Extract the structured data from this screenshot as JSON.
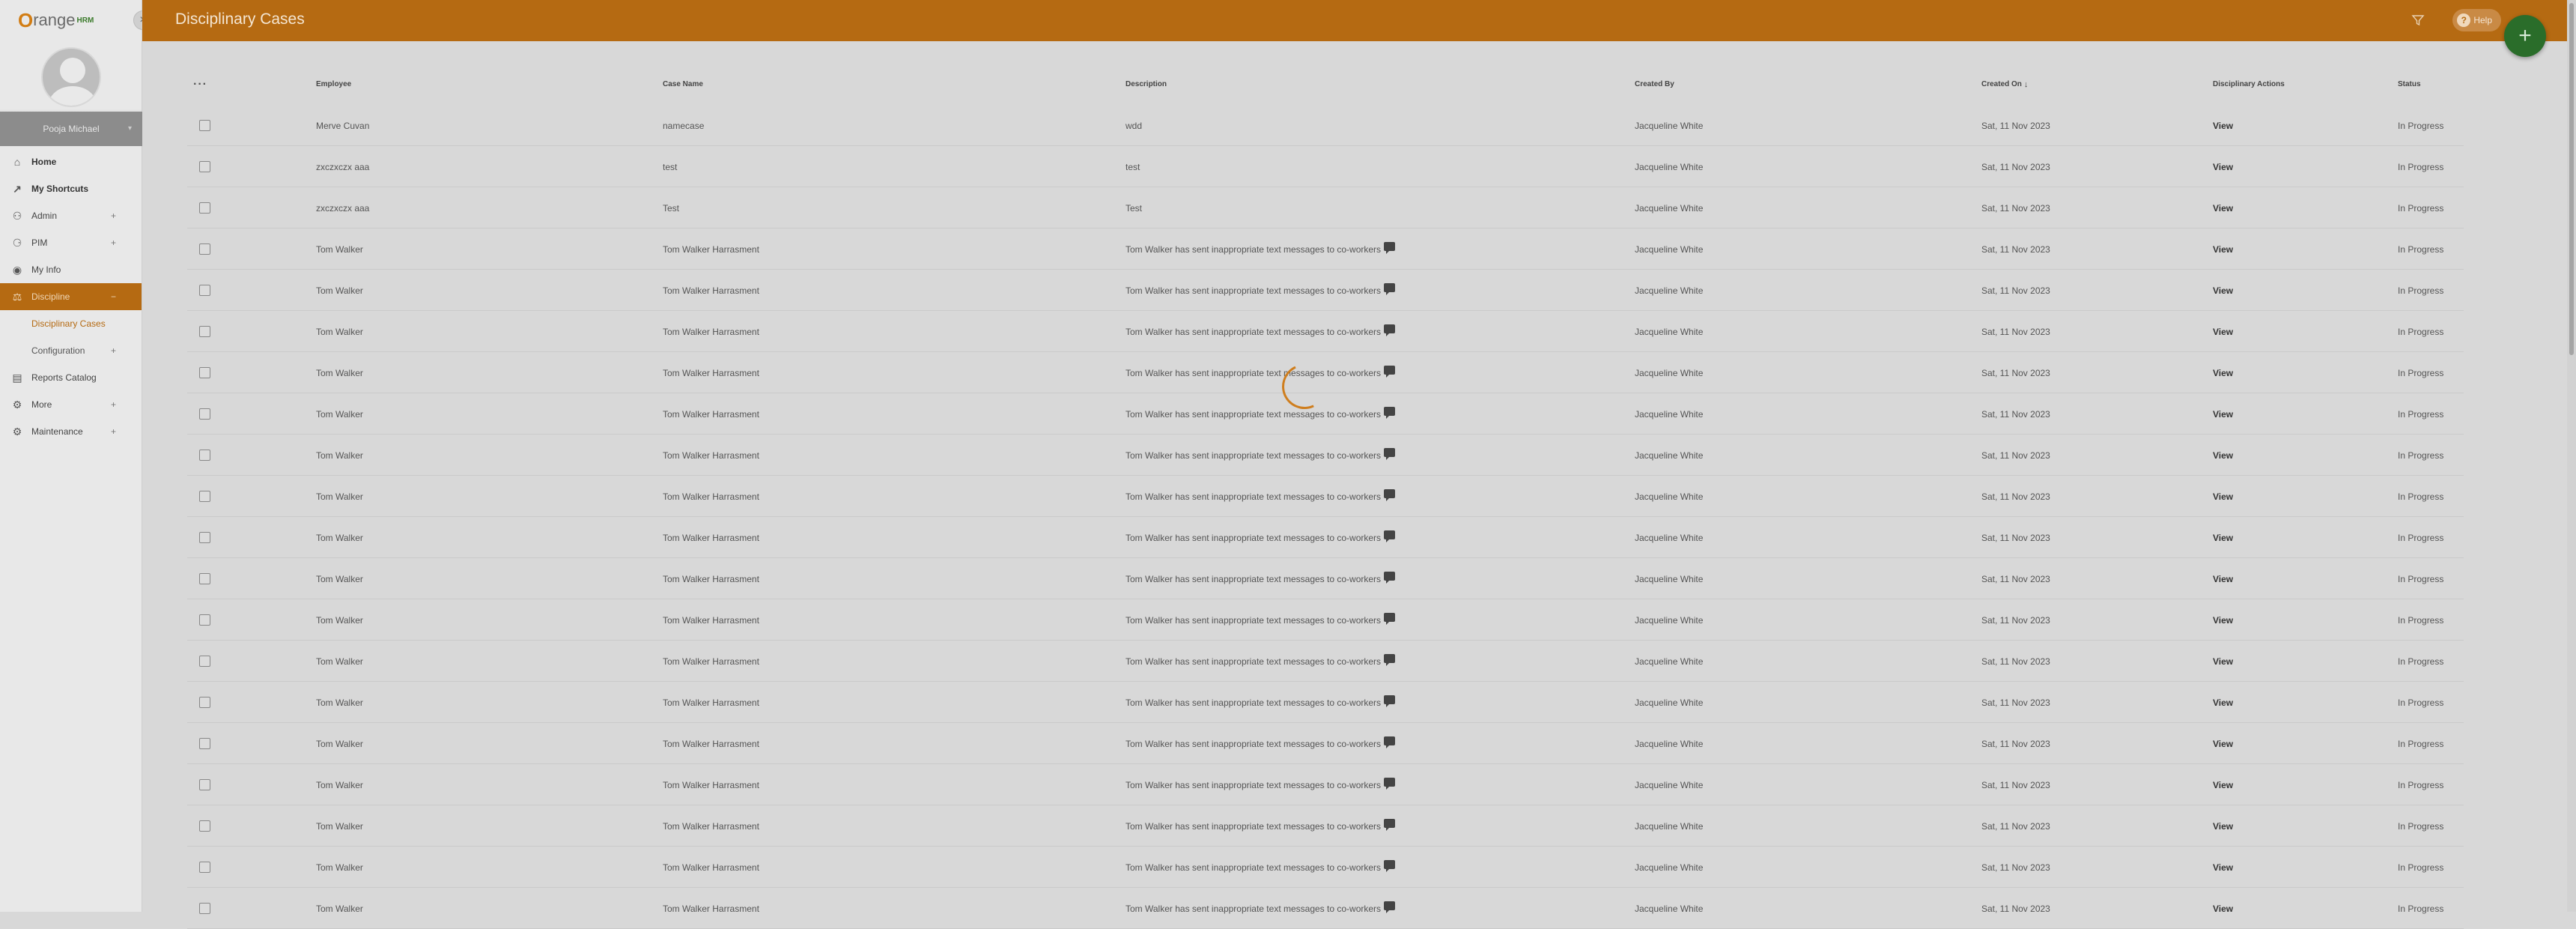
{
  "app": {
    "logo_text": "range",
    "logo_sub": "HRM"
  },
  "sidebar": {
    "user_name": "Pooja Michael",
    "items": [
      {
        "label": "Home",
        "icon": "home-icon",
        "bold": true
      },
      {
        "label": "My Shortcuts",
        "icon": "shortcut-icon",
        "bold": true
      },
      {
        "label": "Admin",
        "icon": "admin-icon",
        "expandable": true
      },
      {
        "label": "PIM",
        "icon": "pim-icon",
        "expandable": true
      },
      {
        "label": "My Info",
        "icon": "user-circle-icon"
      },
      {
        "label": "Discipline",
        "icon": "discipline-icon",
        "active": true
      }
    ],
    "subitems": [
      {
        "label": "Disciplinary Cases",
        "selected": true
      },
      {
        "label": "Configuration",
        "expandable": true
      }
    ],
    "items_after": [
      {
        "label": "Reports Catalog",
        "icon": "reports-icon"
      },
      {
        "label": "More",
        "icon": "more-icon",
        "expandable": true
      },
      {
        "label": "Maintenance",
        "icon": "maintenance-icon",
        "expandable": true
      }
    ]
  },
  "header": {
    "title": "Disciplinary Cases",
    "help_label": "Help"
  },
  "table": {
    "columns": [
      "Employee",
      "Case Name",
      "Description",
      "Created By",
      "Created On",
      "Disciplinary Actions",
      "Status"
    ],
    "rows": [
      {
        "employee": "Merve Cuvan",
        "case": "namecase",
        "desc": "wdd",
        "comment": false,
        "by": "Jacqueline White",
        "on": "Sat, 11 Nov 2023",
        "action": "View",
        "status": "In Progress"
      },
      {
        "employee": "zxczxczx aaa",
        "case": "test",
        "desc": "test",
        "comment": false,
        "by": "Jacqueline White",
        "on": "Sat, 11 Nov 2023",
        "action": "View",
        "status": "In Progress"
      },
      {
        "employee": "zxczxczx aaa",
        "case": "Test",
        "desc": "Test",
        "comment": false,
        "by": "Jacqueline White",
        "on": "Sat, 11 Nov 2023",
        "action": "View",
        "status": "In Progress"
      },
      {
        "employee": "Tom Walker",
        "case": "Tom Walker Harrasment",
        "desc": "Tom Walker has sent inappropriate text messages to co-workers",
        "comment": true,
        "by": "Jacqueline White",
        "on": "Sat, 11 Nov 2023",
        "action": "View",
        "status": "In Progress"
      },
      {
        "employee": "Tom Walker",
        "case": "Tom Walker Harrasment",
        "desc": "Tom Walker has sent inappropriate text messages to co-workers",
        "comment": true,
        "by": "Jacqueline White",
        "on": "Sat, 11 Nov 2023",
        "action": "View",
        "status": "In Progress"
      },
      {
        "employee": "Tom Walker",
        "case": "Tom Walker Harrasment",
        "desc": "Tom Walker has sent inappropriate text messages to co-workers",
        "comment": true,
        "by": "Jacqueline White",
        "on": "Sat, 11 Nov 2023",
        "action": "View",
        "status": "In Progress"
      },
      {
        "employee": "Tom Walker",
        "case": "Tom Walker Harrasment",
        "desc": "Tom Walker has sent inappropriate text messages to co-workers",
        "comment": true,
        "by": "Jacqueline White",
        "on": "Sat, 11 Nov 2023",
        "action": "View",
        "status": "In Progress"
      },
      {
        "employee": "Tom Walker",
        "case": "Tom Walker Harrasment",
        "desc": "Tom Walker has sent inappropriate text messages to co-workers",
        "comment": true,
        "by": "Jacqueline White",
        "on": "Sat, 11 Nov 2023",
        "action": "View",
        "status": "In Progress"
      },
      {
        "employee": "Tom Walker",
        "case": "Tom Walker Harrasment",
        "desc": "Tom Walker has sent inappropriate text messages to co-workers",
        "comment": true,
        "by": "Jacqueline White",
        "on": "Sat, 11 Nov 2023",
        "action": "View",
        "status": "In Progress"
      },
      {
        "employee": "Tom Walker",
        "case": "Tom Walker Harrasment",
        "desc": "Tom Walker has sent inappropriate text messages to co-workers",
        "comment": true,
        "by": "Jacqueline White",
        "on": "Sat, 11 Nov 2023",
        "action": "View",
        "status": "In Progress"
      },
      {
        "employee": "Tom Walker",
        "case": "Tom Walker Harrasment",
        "desc": "Tom Walker has sent inappropriate text messages to co-workers",
        "comment": true,
        "by": "Jacqueline White",
        "on": "Sat, 11 Nov 2023",
        "action": "View",
        "status": "In Progress"
      },
      {
        "employee": "Tom Walker",
        "case": "Tom Walker Harrasment",
        "desc": "Tom Walker has sent inappropriate text messages to co-workers",
        "comment": true,
        "by": "Jacqueline White",
        "on": "Sat, 11 Nov 2023",
        "action": "View",
        "status": "In Progress"
      },
      {
        "employee": "Tom Walker",
        "case": "Tom Walker Harrasment",
        "desc": "Tom Walker has sent inappropriate text messages to co-workers",
        "comment": true,
        "by": "Jacqueline White",
        "on": "Sat, 11 Nov 2023",
        "action": "View",
        "status": "In Progress"
      },
      {
        "employee": "Tom Walker",
        "case": "Tom Walker Harrasment",
        "desc": "Tom Walker has sent inappropriate text messages to co-workers",
        "comment": true,
        "by": "Jacqueline White",
        "on": "Sat, 11 Nov 2023",
        "action": "View",
        "status": "In Progress"
      },
      {
        "employee": "Tom Walker",
        "case": "Tom Walker Harrasment",
        "desc": "Tom Walker has sent inappropriate text messages to co-workers",
        "comment": true,
        "by": "Jacqueline White",
        "on": "Sat, 11 Nov 2023",
        "action": "View",
        "status": "In Progress"
      },
      {
        "employee": "Tom Walker",
        "case": "Tom Walker Harrasment",
        "desc": "Tom Walker has sent inappropriate text messages to co-workers",
        "comment": true,
        "by": "Jacqueline White",
        "on": "Sat, 11 Nov 2023",
        "action": "View",
        "status": "In Progress"
      },
      {
        "employee": "Tom Walker",
        "case": "Tom Walker Harrasment",
        "desc": "Tom Walker has sent inappropriate text messages to co-workers",
        "comment": true,
        "by": "Jacqueline White",
        "on": "Sat, 11 Nov 2023",
        "action": "View",
        "status": "In Progress"
      },
      {
        "employee": "Tom Walker",
        "case": "Tom Walker Harrasment",
        "desc": "Tom Walker has sent inappropriate text messages to co-workers",
        "comment": true,
        "by": "Jacqueline White",
        "on": "Sat, 11 Nov 2023",
        "action": "View",
        "status": "In Progress"
      },
      {
        "employee": "Tom Walker",
        "case": "Tom Walker Harrasment",
        "desc": "Tom Walker has sent inappropriate text messages to co-workers",
        "comment": true,
        "by": "Jacqueline White",
        "on": "Sat, 11 Nov 2023",
        "action": "View",
        "status": "In Progress"
      },
      {
        "employee": "Tom Walker",
        "case": "Tom Walker Harrasment",
        "desc": "Tom Walker has sent inappropriate text messages to co-workers",
        "comment": true,
        "by": "Jacqueline White",
        "on": "Sat, 11 Nov 2023",
        "action": "View",
        "status": "In Progress"
      }
    ]
  },
  "colors": {
    "brand": "#b56a12",
    "fab": "#2a6d2a",
    "overlay": "#d8d8d8"
  }
}
